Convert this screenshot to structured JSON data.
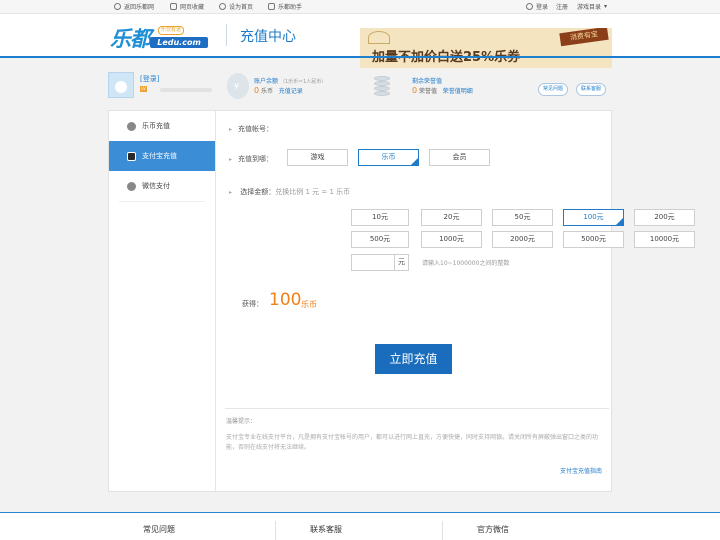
{
  "topbar": {
    "left_links": [
      "返回乐都网",
      "网页收藏",
      "设为首页",
      "乐都助手"
    ],
    "login": "登录",
    "register": "注册",
    "game_menu": "游戏目录"
  },
  "header": {
    "logo_cn": "乐都",
    "logo_en": "Ledu.com",
    "logo_tag": "乐饮有道",
    "title": "充值中心",
    "banner_text": "加量不加价白送25%乐券",
    "banner_badge": "消费有宝"
  },
  "user": {
    "login_link": "[登录]",
    "level_badge": "LV",
    "balance_title": "账户余额",
    "balance_note": "（1乐币＝1人民币）",
    "balance_value": "0",
    "balance_unit": "乐币",
    "balance_record": "充值记录",
    "rong_title": "剩余荣誉值",
    "rong_value": "0",
    "rong_unit": "荣誉值",
    "rong_detail": "荣誉值明细",
    "faq_button": "常见问题",
    "service_button": "联系客服"
  },
  "sidebar": {
    "items": [
      {
        "label": "乐币充值",
        "icon": "coin-icon"
      },
      {
        "label": "支付宝充值",
        "icon": "alipay-shield-icon"
      },
      {
        "label": "微信支付",
        "icon": "wechat-icon"
      }
    ],
    "active_index": 1
  },
  "form": {
    "account_label": "充值帐号：",
    "target_label": "充值到哪：",
    "targets": [
      "游戏",
      "乐币",
      "会员"
    ],
    "selected_target": "乐币",
    "amount_label": "选择金额：",
    "ratio_hint": "兑换比例 1 元 = 1 乐币",
    "amounts": [
      "10元",
      "20元",
      "50元",
      "100元",
      "200元",
      "500元",
      "1000元",
      "2000元",
      "5000元",
      "10000元"
    ],
    "selected_amount": "100元",
    "custom_amount_value": "",
    "custom_unit": "元",
    "range_hint": "请输入10~1000000之间的整数",
    "get_label": "获得：",
    "get_value": "100",
    "get_unit": "乐币",
    "submit_label": "立即充值"
  },
  "tips": {
    "title": "温馨提示：",
    "body": "支付宝专业在线支付平台，凡是拥有支付宝帐号的用户，都可以进行网上直充，方便快捷，同时支持网银。请关闭所有屏蔽弹出窗口之类的功能，否则在线支付将无法继续。",
    "guide_link": "支付宝充值指南"
  },
  "footer": {
    "columns": [
      "常见问题",
      "联系客服",
      "官方微信"
    ]
  },
  "colors": {
    "accent": "#1f7bc8",
    "sidebar_active": "#3b8dd6",
    "submit": "#1a6dbd",
    "highlight": "#f08018"
  }
}
